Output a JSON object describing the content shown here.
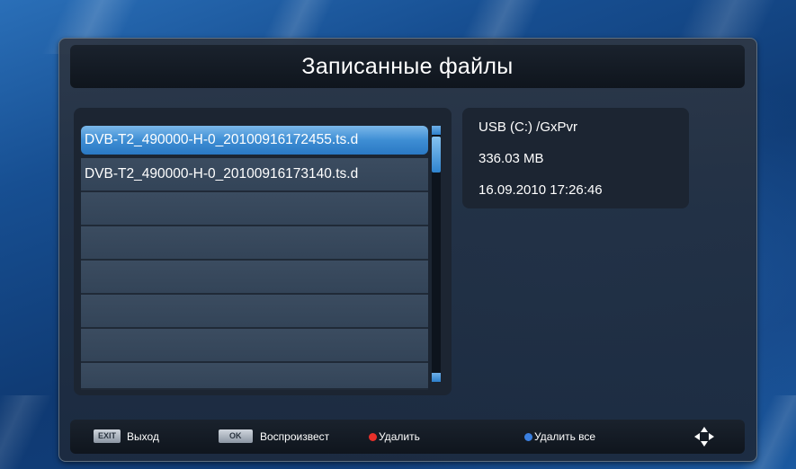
{
  "title": "Записанные файлы",
  "files": [
    {
      "name": "DVB-T2_490000-H-0_20100916172455.ts.d",
      "selected": true
    },
    {
      "name": "DVB-T2_490000-H-0_20100916173140.ts.d",
      "selected": false
    },
    {
      "name": ""
    },
    {
      "name": ""
    },
    {
      "name": ""
    },
    {
      "name": ""
    },
    {
      "name": ""
    },
    {
      "name": ""
    }
  ],
  "info": {
    "path": "USB (C:) /GxPvr",
    "size": "336.03 MB",
    "datetime": "16.09.2010 17:26:46"
  },
  "footer": {
    "exit_key": "EXIT",
    "exit_label": "Выход",
    "ok_key": "OK",
    "ok_label": "Воспроизвест",
    "delete_label": "Удалить",
    "delete_color": "#e8302a",
    "delete_all_label": "Удалить все",
    "delete_all_color": "#3a7fe0"
  },
  "colors": {
    "selection": "#3e8ed4",
    "panel": "#1c2532",
    "background": "#174f92"
  }
}
